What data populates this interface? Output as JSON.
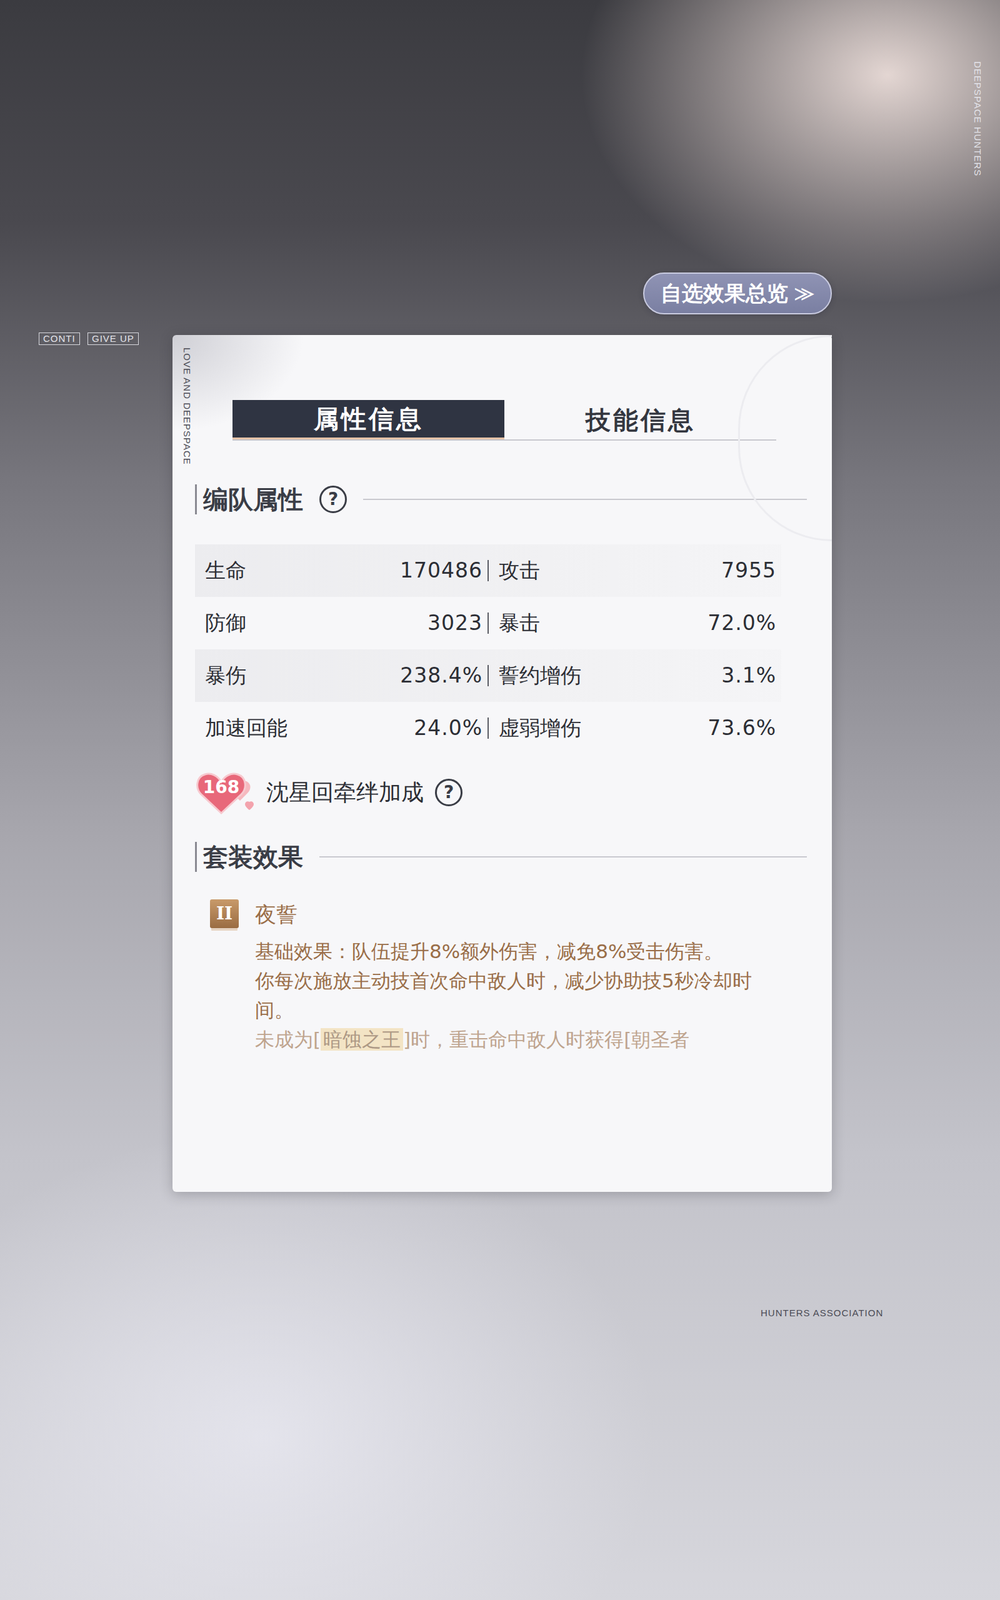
{
  "window": {
    "title": "属性信息"
  },
  "overview_button": {
    "label": "自选效果总览",
    "icon": "≫"
  },
  "decor": {
    "panel_side": "LOVE AND DEEPSPACE",
    "edge_side": "DEEPSPACE HUNTERS",
    "back_buttons": [
      "CONTI",
      "GIVE UP"
    ],
    "footer": "HUNTERS ASSOCIATION"
  },
  "tabs": [
    {
      "label": "属性信息",
      "selected": true
    },
    {
      "label": "技能信息",
      "selected": false
    }
  ],
  "team_section": {
    "title": "编队属性",
    "help": "?"
  },
  "stats": [
    [
      {
        "label": "生命",
        "value": "170486"
      },
      {
        "label": "攻击",
        "value": "7955"
      }
    ],
    [
      {
        "label": "防御",
        "value": "3023"
      },
      {
        "label": "暴击",
        "value": "72.0%"
      }
    ],
    [
      {
        "label": "暴伤",
        "value": "238.4%"
      },
      {
        "label": "誓约增伤",
        "value": "3.1%"
      }
    ],
    [
      {
        "label": "加速回能",
        "value": "24.0%"
      },
      {
        "label": "虚弱增伤",
        "value": "73.6%"
      }
    ]
  ],
  "bond": {
    "level": "168",
    "label": "沈星回牵绊加成",
    "help": "?"
  },
  "set_section": {
    "title": "套装效果"
  },
  "sets": [
    {
      "tier": "II",
      "name": "夜誓",
      "paragraphs": [
        [
          {
            "text": "基础效果：队伍提升8%额外伤害，减免8%受击伤害。",
            "highlight": false
          }
        ],
        [
          {
            "text": "你每次施放主动技首次命中敌人时，减少协助技5秒冷却时间。",
            "highlight": false
          }
        ],
        [
          {
            "text": "未成为[",
            "highlight": false
          },
          {
            "text": "暗蚀之王",
            "highlight": true
          },
          {
            "text": "]时，重击命中敌人时获得[朝圣者",
            "highlight": false
          }
        ]
      ]
    }
  ]
}
